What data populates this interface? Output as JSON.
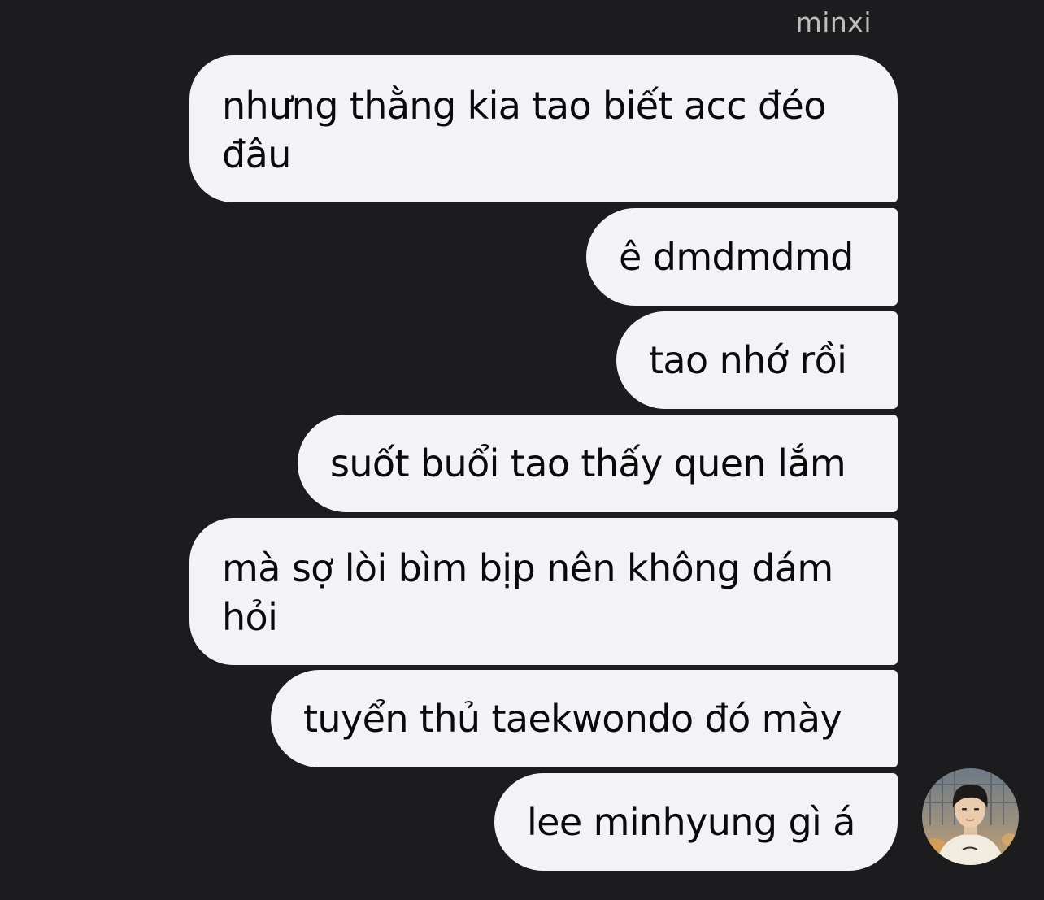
{
  "chat": {
    "sender_name": "minxi",
    "messages": [
      {
        "text": "nhưng thằng kia tao biết acc đéo đâu"
      },
      {
        "text": "ê dmdmdmd"
      },
      {
        "text": "tao nhớ rồi"
      },
      {
        "text": "suốt buổi tao thấy quen lắm"
      },
      {
        "text": "mà sợ lòi bìm bịp nên không dám hỏi"
      },
      {
        "text": "tuyển thủ taekwondo đó mày"
      },
      {
        "text": "lee minhyung gì á"
      }
    ]
  },
  "colors": {
    "background": "#1c1c1e",
    "bubble": "#f2f2f7",
    "text": "#0a0a0a",
    "sender_name": "#bdbdbd"
  },
  "icons": {
    "avatar": "profile-photo"
  }
}
